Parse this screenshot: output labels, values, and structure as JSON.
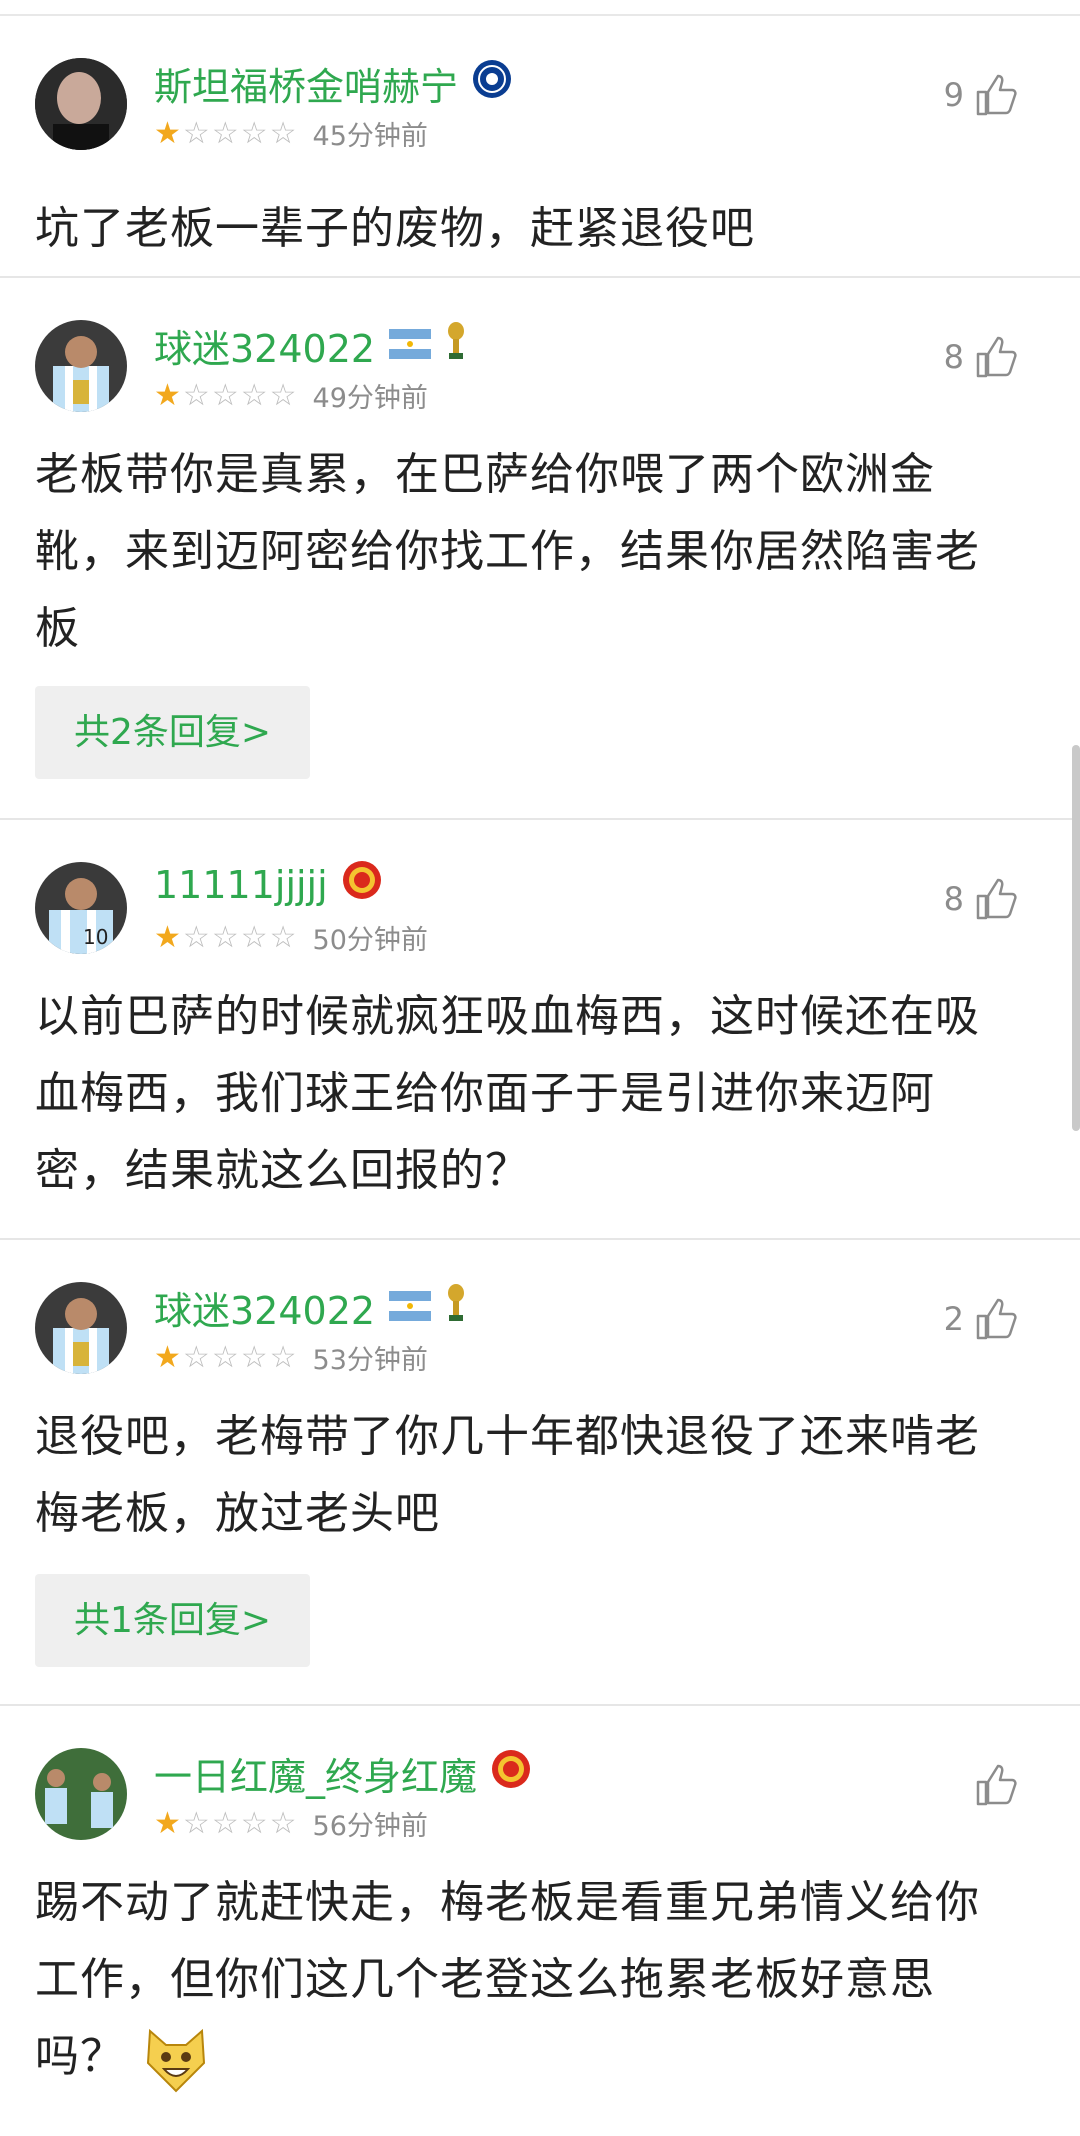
{
  "comments": [
    {
      "username": "斯坦福桥金哨赫宁",
      "stars_filled": 1,
      "stars_total": 5,
      "time": "45分钟前",
      "likes": "9",
      "text": "坑了老板一辈子的废物，赶紧退役吧"
    },
    {
      "username": "球迷324022",
      "stars_filled": 1,
      "stars_total": 5,
      "time": "49分钟前",
      "likes": "8",
      "text_lines": [
        "老板带你是真累，在巴萨给你喂了两个欧洲金",
        "靴，来到迈阿密给你找工作，结果你居然陷害老",
        "板"
      ],
      "reply_label": "共2条回复>"
    },
    {
      "username": "11111jjjjj",
      "stars_filled": 1,
      "stars_total": 5,
      "time": "50分钟前",
      "likes": "8",
      "text_lines": [
        "以前巴萨的时候就疯狂吸血梅西，这时候还在吸",
        "血梅西，我们球王给你面子于是引进你来迈阿",
        "密，结果就这么回报的？"
      ]
    },
    {
      "username": "球迷324022",
      "stars_filled": 1,
      "stars_total": 5,
      "time": "53分钟前",
      "likes": "2",
      "text_lines": [
        "退役吧，老梅带了你几十年都快退役了还来啃老",
        "梅老板，放过老头吧"
      ],
      "reply_label": "共1条回复>"
    },
    {
      "username": "一日红魔_终身红魔",
      "stars_filled": 1,
      "stars_total": 5,
      "time": "56分钟前",
      "likes": "",
      "text_lines": [
        "踢不动了就赶快走，梅老板是看重兄弟情义给你",
        "工作，但你们这几个老登这么拖累老板好意思",
        "吗？"
      ]
    }
  ],
  "colors": {
    "username": "#2fa84f",
    "star": "#f2a81d",
    "reply_bg": "#efefef"
  }
}
